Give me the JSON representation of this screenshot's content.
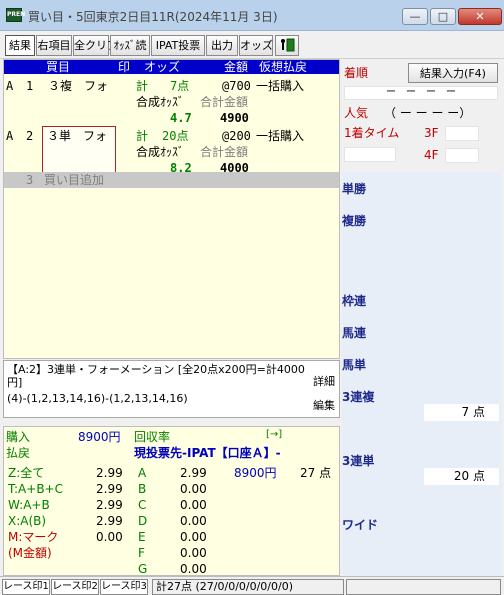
{
  "window": {
    "app_icon_text": "PREN",
    "title": "買い目・5回東京2日目11R(2024年11月 3日)"
  },
  "toolbar": {
    "buttons": [
      "結果",
      "右項目",
      "全クリア",
      "ｵｯｽﾞ読",
      "IPAT投票",
      "出力",
      "オッズ"
    ]
  },
  "bet_table": {
    "headers": {
      "kaime": "買目",
      "mark": "印",
      "odds": "オッズ",
      "amount": "金額",
      "payout": "仮想払戻"
    },
    "rows": [
      {
        "group": "A",
        "index": "1",
        "type": "３複",
        "method": "フォ",
        "count_label": "計",
        "count": "7点",
        "unit": "@700",
        "buy_mode": "一括購入",
        "combined_label": "合成ｵｯｽﾞ",
        "total_label": "合計金額",
        "combined_odds": "4.7",
        "total": "4900"
      },
      {
        "group": "A",
        "index": "2",
        "type": "３単",
        "method": "フォ",
        "count_label": "計",
        "count": "20点",
        "unit": "@200",
        "buy_mode": "一括購入",
        "combined_label": "合成ｵｯｽﾞ",
        "total_label": "合計金額",
        "combined_odds": "8.2",
        "total": "4000"
      }
    ],
    "add_row": {
      "index": "3",
      "label": "買い目追加"
    }
  },
  "detail": {
    "line1": "【A:2】3連単・フォーメーション [全20点x200円=計4000円]",
    "line2": "(4)-(1,2,13,14,16)-(1,2,13,14,16)",
    "btn_detail": "詳細",
    "btn_edit": "編集"
  },
  "payout": {
    "purchase_label": "購入",
    "purchase_amount": "8900円",
    "refund_label": "払戻",
    "recovery_label": "回収率",
    "arrow": "[→]",
    "vote_dest": "現投票先-IPAT【口座Ａ】-",
    "left_rows": [
      {
        "label": "Z:全て",
        "odds": "2.99",
        "color": "#008000"
      },
      {
        "label": "T:A+B+C",
        "odds": "2.99",
        "color": "#008000"
      },
      {
        "label": "W:A+B",
        "odds": "2.99",
        "color": "#008000"
      },
      {
        "label": "X:A(B)",
        "odds": "2.99",
        "color": "#008000"
      },
      {
        "label": "M:マーク",
        "odds": "0.00",
        "color": "#c00000"
      },
      {
        "label": "(M金額)",
        "odds": "",
        "color": "#c00000"
      }
    ],
    "right_rows": [
      {
        "label": "A",
        "odds": "2.99",
        "amount": "8900円",
        "count": "27 点"
      },
      {
        "label": "B",
        "odds": "0.00"
      },
      {
        "label": "C",
        "odds": "0.00"
      },
      {
        "label": "D",
        "odds": "0.00"
      },
      {
        "label": "E",
        "odds": "0.00"
      },
      {
        "label": "F",
        "odds": "0.00"
      },
      {
        "label": "G",
        "odds": "0.00"
      }
    ]
  },
  "right_panel": {
    "order_label": "着順",
    "result_button": "結果入力(F4)",
    "order_values": "ー　ー　ー　ー",
    "popularity_label": "人気",
    "popularity_values": "（ ー ー ー ー）",
    "first_time_label": "1着タイム",
    "f3": "3F",
    "f4": "4F",
    "bet_types": [
      {
        "label": "単勝",
        "value": ""
      },
      {
        "label": "複勝",
        "value": ""
      },
      {
        "label": "枠連",
        "value": ""
      },
      {
        "label": "馬連",
        "value": ""
      },
      {
        "label": "馬単",
        "value": ""
      },
      {
        "label": "3連複",
        "value": "7 点"
      },
      {
        "label": "3連単",
        "value": "20 点"
      },
      {
        "label": "ワイド",
        "value": ""
      }
    ]
  },
  "statusbar": {
    "tabs": [
      "レース印1",
      "レース印2",
      "レース印3"
    ],
    "summary": "計27点 (27/0/0/0/0/0/0/0)"
  }
}
